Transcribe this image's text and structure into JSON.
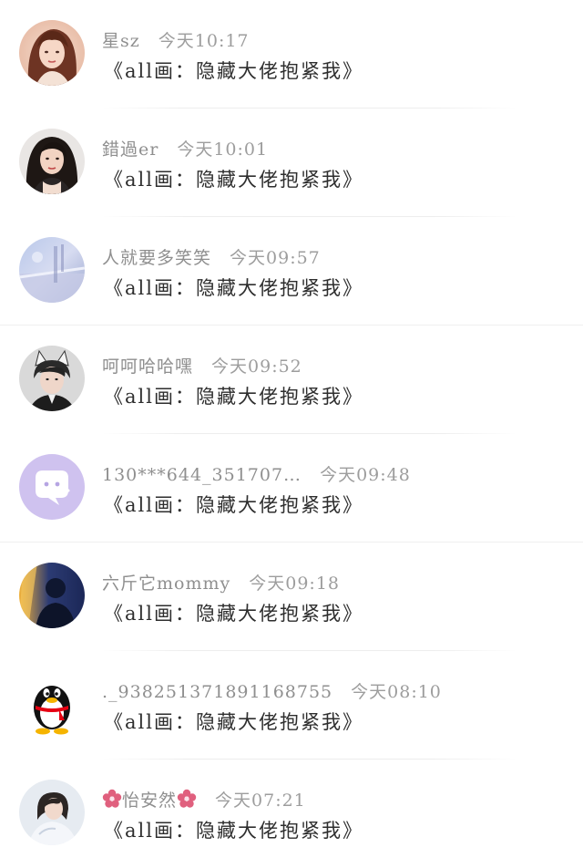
{
  "comments": [
    {
      "username": "星sz",
      "time": "今天10:17",
      "message": "《all画：隐藏大佬抱紧我》",
      "avatar": "avatar-girl-photo-icon"
    },
    {
      "username": "錯過er",
      "time": "今天10:01",
      "message": "《all画：隐藏大佬抱紧我》",
      "avatar": "avatar-woman-photo-icon"
    },
    {
      "username": "人就要多笑笑",
      "time": "今天09:57",
      "message": "《all画：隐藏大佬抱紧我》",
      "avatar": "avatar-pastel-scene-icon"
    },
    {
      "username": "呵呵哈哈嘿",
      "time": "今天09:52",
      "message": "《all画：隐藏大佬抱紧我》",
      "avatar": "avatar-boy-cat-ears-icon"
    },
    {
      "username": "130***644_351707…",
      "time": "今天09:48",
      "message": "《all画：隐藏大佬抱紧我》",
      "avatar": "default-chat-bubble-avatar-icon"
    },
    {
      "username": "六斤它mommy",
      "time": "今天09:18",
      "message": "《all画：隐藏大佬抱紧我》",
      "avatar": "avatar-silhouette-sunset-icon"
    },
    {
      "username": "._938251371891168755",
      "time": "今天08:10",
      "message": "《all画：隐藏大佬抱紧我》",
      "avatar": "qq-penguin-avatar-icon"
    },
    {
      "username": "怡安然",
      "time": "今天07:21",
      "message": "《all画：隐藏大佬抱紧我》",
      "avatar": "avatar-girl-white-shirt-icon",
      "name_decoration": "pink-flower-icon"
    }
  ],
  "colors": {
    "username": "#8f8f8f",
    "message": "#2e2e2e",
    "divider": "#ededed",
    "default_avatar_bg": "#cfc2ef",
    "flower": "#e0607e"
  }
}
